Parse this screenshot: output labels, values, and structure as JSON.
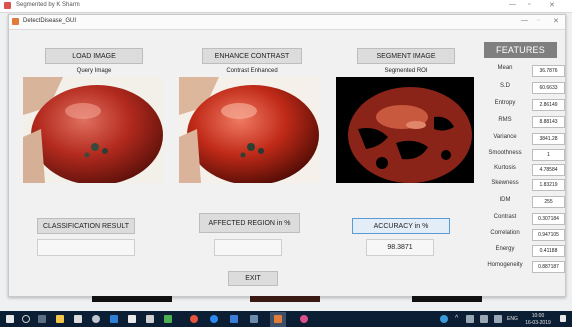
{
  "outer_window": {
    "title": "Segmented by K Sharm"
  },
  "window": {
    "title": "DetectDisease_GUI"
  },
  "buttons": {
    "load_image": "LOAD IMAGE",
    "enhance_contrast": "ENHANCE CONTRAST",
    "segment_image": "SEGMENT IMAGE",
    "classification_result": "CLASSIFICATION RESULT",
    "affected_region": "AFFECTED REGION in %",
    "accuracy": "ACCURACY in %",
    "exit": "EXIT"
  },
  "captions": {
    "query": "Query Image",
    "enhanced": "Contrast Enhanced",
    "segmented": "Segmented ROI"
  },
  "results": {
    "classification": "",
    "affected_region": "",
    "accuracy": "98.3871"
  },
  "features": {
    "header": "FEATURES",
    "items": [
      {
        "label": "Mean",
        "value": "36.7876"
      },
      {
        "label": "S.D",
        "value": "60.6633"
      },
      {
        "label": "Entropy",
        "value": "2.86149"
      },
      {
        "label": "RMS",
        "value": "8.88143"
      },
      {
        "label": "Variance",
        "value": "3841.28"
      },
      {
        "label": "Smoothness",
        "value": "1"
      },
      {
        "label": "Kurtosis",
        "value": "4.78584"
      },
      {
        "label": "Skewness",
        "value": "1.83219"
      },
      {
        "label": "IDM",
        "value": "255"
      },
      {
        "label": "Contrast",
        "value": "0.307184"
      },
      {
        "label": "Correlation",
        "value": "0.947105"
      },
      {
        "label": "Energy",
        "value": "0.41188"
      },
      {
        "label": "Homogeneity",
        "value": "0.887187"
      }
    ]
  },
  "taskbar": {
    "time": "10:00",
    "date": "16-03-2019",
    "language": "ENG",
    "icons": [
      "windows-icon",
      "search-icon",
      "task-view-icon",
      "file-explorer-icon",
      "store-icon",
      "settings-icon",
      "bluetooth-icon",
      "mail-icon",
      "photos-icon",
      "chrome-icon",
      "edge-icon",
      "matlab-icon",
      "network-icon",
      "tool-icon",
      "app-icon",
      "maps-icon"
    ]
  },
  "colors": {
    "accent": "#5b9bd5",
    "features_header": "#7f7f7f",
    "taskbar": "#0b1e33"
  }
}
